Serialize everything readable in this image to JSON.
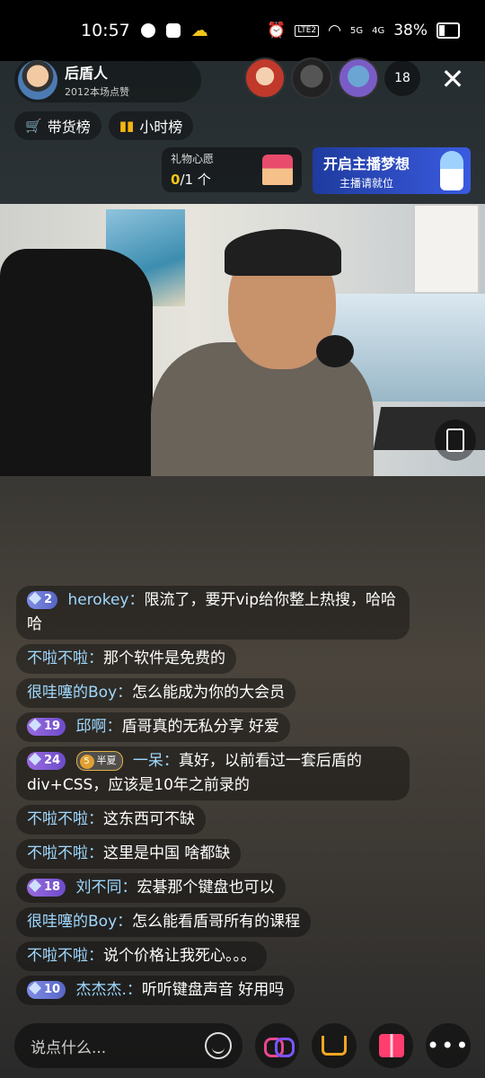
{
  "status_bar": {
    "time": "10:57",
    "lte_label": "LTE2",
    "net1": "5G",
    "net2": "4G",
    "battery": "38%"
  },
  "host": {
    "name": "后盾人",
    "likes": "2012本场点赞"
  },
  "viewers": {
    "count": "18"
  },
  "rank": {
    "goods": "带货榜",
    "hour": "小时榜"
  },
  "wish": {
    "title": "礼物心愿",
    "current": "0",
    "total": "/1 个"
  },
  "banner": {
    "line1": "开启主播梦想",
    "line2": "主播请就位"
  },
  "chat": [
    {
      "level": "2",
      "name": "herokey：",
      "text": "限流了，要开vip给你整上热搜，哈哈哈"
    },
    {
      "name": "不啦不啦：",
      "text": "那个软件是免费的"
    },
    {
      "name": "很哇噻的Boy：",
      "text": "怎么能成为你的大会员"
    },
    {
      "level": "19",
      "name": "邱啊：",
      "text": "盾哥真的无私分享 好爱"
    },
    {
      "level": "24",
      "fan_level": "5",
      "fan_name": "半夏",
      "name": "一呆：",
      "text": "真好，以前看过一套后盾的div+CSS，应该是10年之前录的"
    },
    {
      "name": "不啦不啦：",
      "text": "这东西可不缺"
    },
    {
      "name": "不啦不啦：",
      "text": "这里是中国 啥都缺"
    },
    {
      "level": "18",
      "name": "刘不同：",
      "text": "宏碁那个键盘也可以"
    },
    {
      "name": "很哇噻的Boy：",
      "text": "怎么能看盾哥所有的课程"
    },
    {
      "name": "不啦不啦：",
      "text": "说个价格让我死心。。。"
    },
    {
      "level": "10",
      "name": "杰杰杰.：",
      "text": "听听键盘声音 好用吗"
    }
  ],
  "input": {
    "placeholder": "说点什么..."
  },
  "icons": {
    "close": "close-icon",
    "rotate": "rotate-screen-icon",
    "link": "link-icon",
    "cart": "cart-icon",
    "gift": "gift-icon",
    "more": "more-icon",
    "emoji": "emoji-icon"
  },
  "colors": {
    "username": "#9fd8ff",
    "wish_number": "#f5c518",
    "cart": "#f5a623",
    "gift": "#ff3d6e"
  }
}
